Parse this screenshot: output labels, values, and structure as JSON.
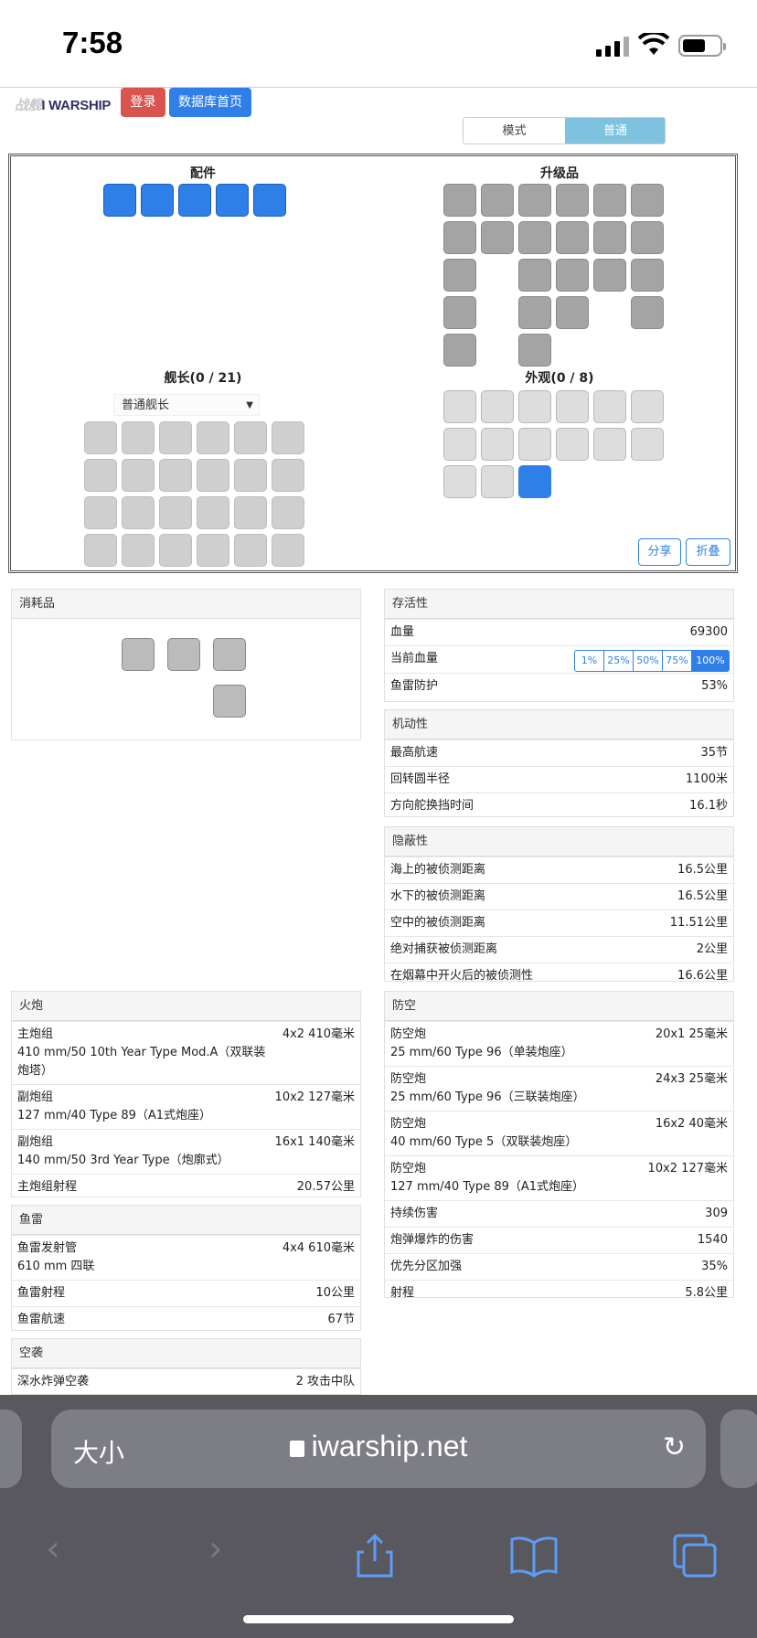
{
  "status": {
    "time": "7:58"
  },
  "site": {
    "logo": "I WARSHIP",
    "logo_prefix": "战舰",
    "login": "登录",
    "db_home": "数据库首页"
  },
  "mode": {
    "label1": "模式",
    "label2": "普通"
  },
  "config": {
    "accessories_title": "配件",
    "upgrades_title": "升级品",
    "captain_title": "舰长(0 / 21)",
    "captain_select": "普通舰长",
    "appearance_title": "外观(0 / 8)",
    "share": "分享",
    "fold": "折叠"
  },
  "consumables": {
    "title": "消耗品"
  },
  "survival": {
    "title": "存活性",
    "hp_label": "血量",
    "hp_value": "69300",
    "cur_hp_label": "当前血量",
    "hp_options": [
      "1%",
      "25%",
      "50%",
      "75%",
      "100%"
    ],
    "torp_label": "鱼雷防护",
    "torp_value": "53%"
  },
  "mobility": {
    "title": "机动性",
    "rows": [
      {
        "label": "最高航速",
        "value": "35节"
      },
      {
        "label": "回转圆半径",
        "value": "1100米"
      },
      {
        "label": "方向舵换挡时间",
        "value": "16.1秒"
      }
    ]
  },
  "conceal": {
    "title": "隐蔽性",
    "rows": [
      {
        "label": "海上的被侦测距离",
        "value": "16.5公里"
      },
      {
        "label": "水下的被侦测距离",
        "value": "16.5公里"
      },
      {
        "label": "空中的被侦测距离",
        "value": "11.51公里"
      },
      {
        "label": "绝对捕获被侦测距离",
        "value": "2公里"
      },
      {
        "label": "在烟幕中开火后的被侦测性",
        "value": "16.6公里"
      }
    ]
  },
  "guns": {
    "title": "火炮",
    "rows": [
      {
        "label": "主炮组",
        "sub": "410 mm/50 10th Year Type Mod.A（双联装炮塔）",
        "value": "4x2 410毫米"
      },
      {
        "label": "副炮组",
        "sub": "127 mm/40 Type 89（A1式炮座）",
        "value": "10x2 127毫米"
      },
      {
        "label": "副炮组",
        "sub": "140 mm/50 3rd Year Type（炮廓式）",
        "value": "16x1 140毫米"
      },
      {
        "label": "主炮组射程",
        "sub": "",
        "value": "20.57公里"
      }
    ]
  },
  "torps": {
    "title": "鱼雷",
    "rows": [
      {
        "label": "鱼雷发射管",
        "sub": "610 mm 四联",
        "value": "4x4 610毫米"
      },
      {
        "label": "鱼雷射程",
        "sub": "",
        "value": "10公里"
      },
      {
        "label": "鱼雷航速",
        "sub": "",
        "value": "67节"
      }
    ]
  },
  "air": {
    "title": "空袭",
    "rows": [
      {
        "label": "深水炸弹空袭",
        "sub": "",
        "value": "2 攻击中队"
      }
    ]
  },
  "aa": {
    "title": "防空",
    "rows": [
      {
        "label": "防空炮",
        "sub": "25 mm/60 Type 96（单装炮座）",
        "value": "20x1 25毫米"
      },
      {
        "label": "防空炮",
        "sub": "25 mm/60 Type 96（三联装炮座）",
        "value": "24x3 25毫米"
      },
      {
        "label": "防空炮",
        "sub": "40 mm/60 Type 5（双联装炮座）",
        "value": "16x2 40毫米"
      },
      {
        "label": "防空炮",
        "sub": "127 mm/40 Type 89（A1式炮座）",
        "value": "10x2 127毫米"
      },
      {
        "label": "持续伤害",
        "sub": "",
        "value": "309"
      },
      {
        "label": "炮弹爆炸的伤害",
        "sub": "",
        "value": "1540"
      },
      {
        "label": "优先分区加强",
        "sub": "",
        "value": "35%"
      },
      {
        "label": "射程",
        "sub": "",
        "value": "5.8公里"
      }
    ]
  },
  "browser": {
    "text_size": "大小",
    "url": "iwarship.net"
  }
}
